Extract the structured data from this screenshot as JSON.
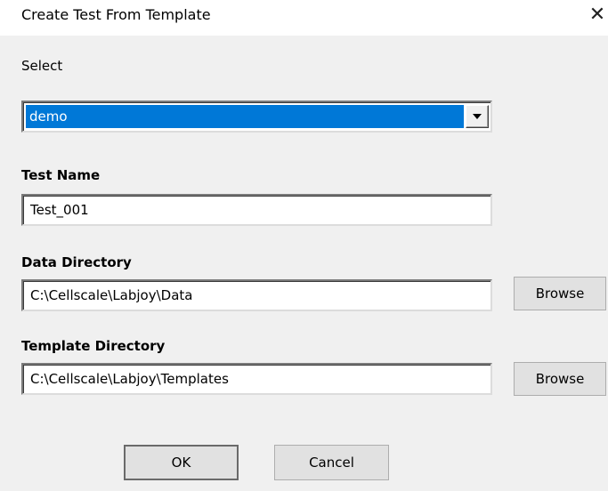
{
  "window": {
    "title": "Create Test From Template",
    "close_glyph": "✕"
  },
  "select": {
    "label": "Select",
    "value": "demo"
  },
  "test_name": {
    "label": "Test Name",
    "value": "Test_001"
  },
  "data_directory": {
    "label": "Data Directory",
    "value": "C:\\Cellscale\\Labjoy\\Data",
    "browse_label": "Browse"
  },
  "template_directory": {
    "label": "Template Directory",
    "value": "C:\\Cellscale\\Labjoy\\Templates",
    "browse_label": "Browse"
  },
  "buttons": {
    "ok": "OK",
    "cancel": "Cancel"
  },
  "icons": {
    "close": "close-icon",
    "dropdown": "chevron-down-icon"
  },
  "colors": {
    "selection_highlight": "#0078d7",
    "dialog_background": "#f0f0f0",
    "titlebar_background": "#ffffff"
  }
}
